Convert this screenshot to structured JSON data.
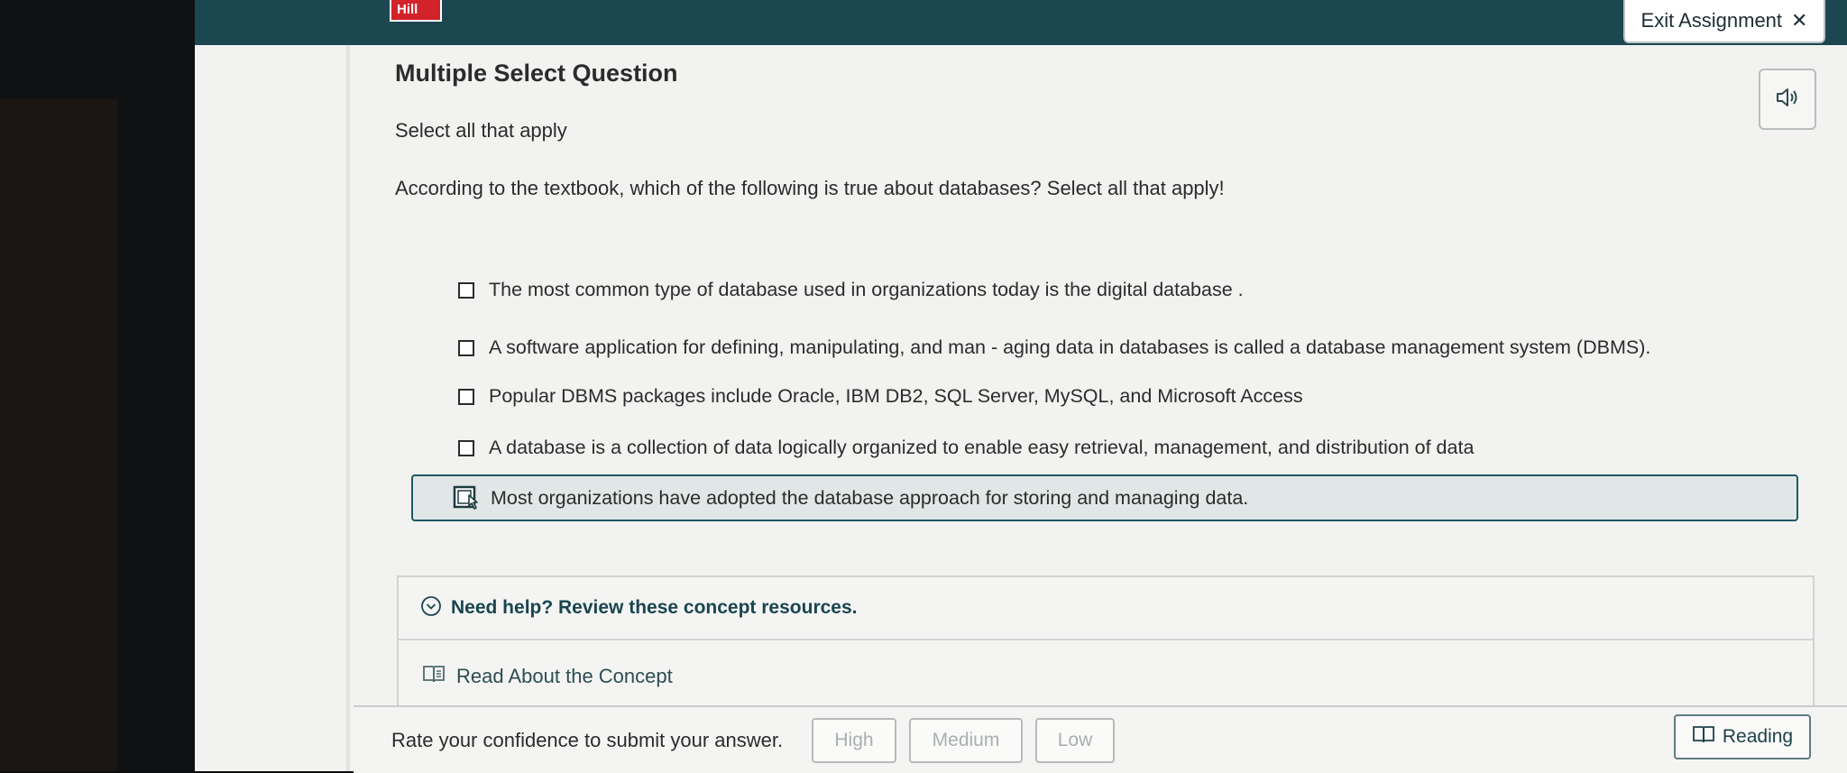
{
  "header": {
    "logo_text": "Hill",
    "exit_label": "Exit Assignment",
    "exit_icon": "close-icon"
  },
  "question": {
    "title": "Multiple Select Question",
    "instruction": "Select all that apply",
    "prompt": "According to the textbook, which of the following is true about databases? Select all that apply!",
    "speaker_icon": "speaker-icon",
    "options": [
      {
        "label": "The most common type of database used in organizations today is the digital database .",
        "selected": false
      },
      {
        "label": "A software application for defining, manipulating, and man - aging data in databases is called a database management system (DBMS).",
        "selected": false
      },
      {
        "label": "Popular DBMS packages include Oracle, IBM DB2, SQL Server, MySQL, and Microsoft Access",
        "selected": false
      },
      {
        "label": "A database is a collection of data logically organized to enable easy retrieval, management, and distribution of data",
        "selected": false
      },
      {
        "label": "Most organizations have adopted the database approach for storing and managing data.",
        "selected": false,
        "hovered": true
      }
    ]
  },
  "help": {
    "title": "Need help? Review these concept resources.",
    "link": "Read About the Concept"
  },
  "footer": {
    "rate_text": "Rate your confidence to submit your answer.",
    "high": "High",
    "medium": "Medium",
    "low": "Low",
    "reading": "Reading"
  },
  "colors": {
    "topbar": "#1c4650",
    "accent": "#1a4550",
    "logo_red": "#d2222a"
  }
}
